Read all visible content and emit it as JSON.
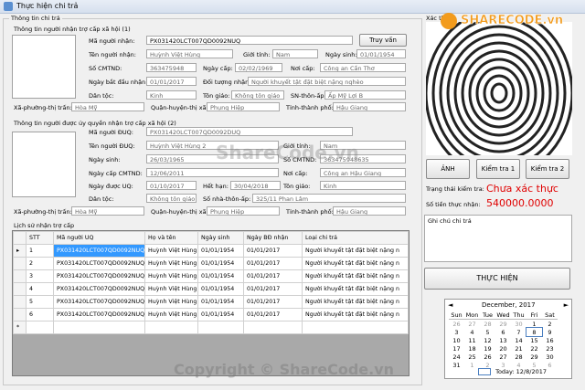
{
  "window": {
    "title": "Thực hiện chi trả"
  },
  "group_main": {
    "title": "Thông tin chi trả"
  },
  "recipient": {
    "section_title": "Thông tin người nhận trợ cấp xã hội (1)",
    "code_label": "Mã người nhận:",
    "code_value": "PX031420LCT007QD0092NUQ",
    "lookup_button": "Truy vấn",
    "name_label": "Tên người nhận:",
    "name_value": "Huỳnh Việt Hùng",
    "gender_label": "Giới tính:",
    "gender_value": "Nam",
    "dob_label": "Ngày sinh:",
    "dob_value": "01/01/1954",
    "id_label": "Số CMTND:",
    "id_value": "363475948",
    "issue_date_label": "Ngày cấp:",
    "issue_date_value": "02/02/1969",
    "issue_place_label": "Nơi cấp:",
    "issue_place_value": "Công an Cần Thơ",
    "start_label": "Ngày bắt đầu nhận:",
    "start_value": "01/01/2017",
    "object_label": "Đối tượng nhận:",
    "object_value": "Người khuyết tật đặt biệt nặng nghèo",
    "ethnic_label": "Dân tộc:",
    "ethnic_value": "Kinh",
    "religion_label": "Tôn giáo:",
    "religion_value": "Không tôn giáo",
    "hamlet_label": "SN-thôn-ấp:",
    "hamlet_value": "Ấp Mỹ Lợi B",
    "ward_label": "Xã-phường-thị trấn:",
    "ward_value": "Hòa Mỹ",
    "district_label": "Quận-huyện-thị xã:",
    "district_value": "Phụng Hiệp",
    "province_label": "Tỉnh-thành phố:",
    "province_value": "Hậu Giang"
  },
  "authorized": {
    "section_title": "Thông tin người được ủy quyền nhận trợ cấp xã hội (2)",
    "code_label": "Mã người ĐUQ:",
    "code_value": "PX031420LCT007QD0092DUQ",
    "name_label": "Tên người ĐUQ:",
    "name_value": "Huỳnh Việt Hùng 2",
    "gender_label": "Giới tính:",
    "gender_value": "Nam",
    "dob_label": "Ngày sinh:",
    "dob_value": "26/03/1965",
    "id_label": "Số CMTND:",
    "id_value": "363475948635",
    "issue_date_label": "Ngày cấp CMTND:",
    "issue_date_value": "12/06/2011",
    "issue_place_label": "Nơi cấp:",
    "issue_place_value": "Công an Hậu Giang",
    "auth_date_label": "Ngày được UQ:",
    "auth_date_value": "01/10/2017",
    "expire_label": "Hết hạn:",
    "expire_value": "30/04/2018",
    "religion_label": "Tôn giáo:",
    "religion_value": "Kinh",
    "ethnic_label": "Dân tộc:",
    "ethnic_value": "Không tôn giáo",
    "house_label": "Số nhà-thôn-ấp:",
    "house_value": "325/11 Phan Lâm",
    "ward_label": "Xã-phường-thị trấn:",
    "ward_value": "Hòa Mỹ",
    "district_label": "Quận-huyện-thị xã:",
    "district_value": "Phụng Hiệp",
    "province_label": "Tỉnh-thành phố:",
    "province_value": "Hậu Giang"
  },
  "history": {
    "section_title": "Lịch sử nhận trợ cấp",
    "columns": [
      "STT",
      "Mã người UQ",
      "Họ và tên",
      "Ngày sinh",
      "Ngày BĐ nhận",
      "Loại chi trả"
    ],
    "rows": [
      [
        "1",
        "PX031420LCT007QD0092NUQ",
        "Huỳnh Việt Hùng",
        "01/01/1954",
        "01/01/2017",
        "Người khuyết tật đặt biệt nặng n"
      ],
      [
        "2",
        "PX031420LCT007QD0092NUQ",
        "Huỳnh Việt Hùng",
        "01/01/1954",
        "01/01/2017",
        "Người khuyết tật đặt biệt nặng n"
      ],
      [
        "3",
        "PX031420LCT007QD0092NUQ",
        "Huỳnh Việt Hùng",
        "01/01/1954",
        "01/01/2017",
        "Người khuyết tật đặt biệt nặng n"
      ],
      [
        "4",
        "PX031420LCT007QD0092NUQ",
        "Huỳnh Việt Hùng",
        "01/01/1954",
        "01/01/2017",
        "Người khuyết tật đặt biệt nặng n"
      ],
      [
        "5",
        "PX031420LCT007QD0092NUQ",
        "Huỳnh Việt Hùng",
        "01/01/1954",
        "01/01/2017",
        "Người khuyết tật đặt biệt nặng n"
      ],
      [
        "6",
        "PX031420LCT007QD0092NUQ",
        "Huỳnh Việt Hùng",
        "01/01/1954",
        "01/01/2017",
        "Người khuyết tật đặt biệt nặng n"
      ]
    ],
    "new_row_marker": "*",
    "current_row_marker": "▸"
  },
  "verify": {
    "title": "Xác th",
    "btn_photo": "ẢNH",
    "btn_check1": "Kiểm tra 1",
    "btn_check2": "Kiểm tra 2",
    "status_label": "Trạng thái kiểm tra:",
    "status_value": "Chưa xác thực",
    "amount_label": "Số tiền thực nhận:",
    "amount_value": "540000.0000",
    "note_placeholder": "Ghi chú chi trả",
    "execute_button": "THỰC HIỆN"
  },
  "calendar": {
    "month_label": "December, 2017",
    "prev": "◄",
    "next": "►",
    "weekdays": [
      "Sun",
      "Mon",
      "Tue",
      "Wed",
      "Thu",
      "Fri",
      "Sat"
    ],
    "weeks": [
      [
        "26",
        "27",
        "28",
        "29",
        "30",
        "1",
        "2"
      ],
      [
        "3",
        "4",
        "5",
        "6",
        "7",
        "8",
        "9"
      ],
      [
        "10",
        "11",
        "12",
        "13",
        "14",
        "15",
        "16"
      ],
      [
        "17",
        "18",
        "19",
        "20",
        "21",
        "22",
        "23"
      ],
      [
        "24",
        "25",
        "26",
        "27",
        "28",
        "29",
        "30"
      ],
      [
        "31",
        "1",
        "2",
        "3",
        "4",
        "5",
        "6"
      ]
    ],
    "today_label": "Today: 12/8/2017"
  },
  "watermark": {
    "text": "ShareCode.vn",
    "copyright": "Copyright © ShareCode.vn",
    "logo_text": "SHARECODE.vn"
  },
  "colors": {
    "status_red": "#e00000",
    "accent_orange": "#f29b1d"
  }
}
